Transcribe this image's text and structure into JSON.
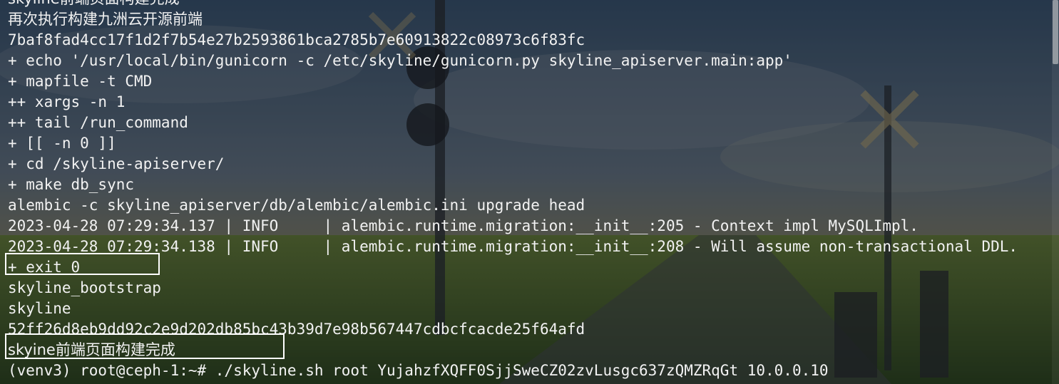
{
  "terminal": {
    "lines": [
      "skyline前端页面构建完成",
      "再次执行构建九洲云开源前端",
      "7baf8fad4cc17f1d2f7b54e27b2593861bca2785b7e60913822c08973c6f83fc",
      "+ echo '/usr/local/bin/gunicorn -c /etc/skyline/gunicorn.py skyline_apiserver.main:app'",
      "+ mapfile -t CMD",
      "++ xargs -n 1",
      "++ tail /run_command",
      "+ [[ -n 0 ]]",
      "+ cd /skyline-apiserver/",
      "+ make db_sync",
      "alembic -c skyline_apiserver/db/alembic/alembic.ini upgrade head",
      "2023-04-28 07:29:34.137 | INFO     | alembic.runtime.migration:__init__:205 - Context impl MySQLImpl.",
      "2023-04-28 07:29:34.138 | INFO     | alembic.runtime.migration:__init__:208 - Will assume non-transactional DDL.",
      "+ exit 0",
      "skyline_bootstrap",
      "skyline",
      "52ff26d8eb9dd92c2e9d202db85bc43b39d7e98b567447cdbcfcacde25f64afd",
      "skyine前端页面构建完成"
    ],
    "prompt": "(venv3) root@ceph-1:~# ./skyline.sh root YujahzfXQFF0SjjSweCZ02zvLusgc637zQMZRqGt 10.0.0.10"
  },
  "colors": {
    "text": "#f2f2f2",
    "highlight_border": "#ffffff"
  }
}
